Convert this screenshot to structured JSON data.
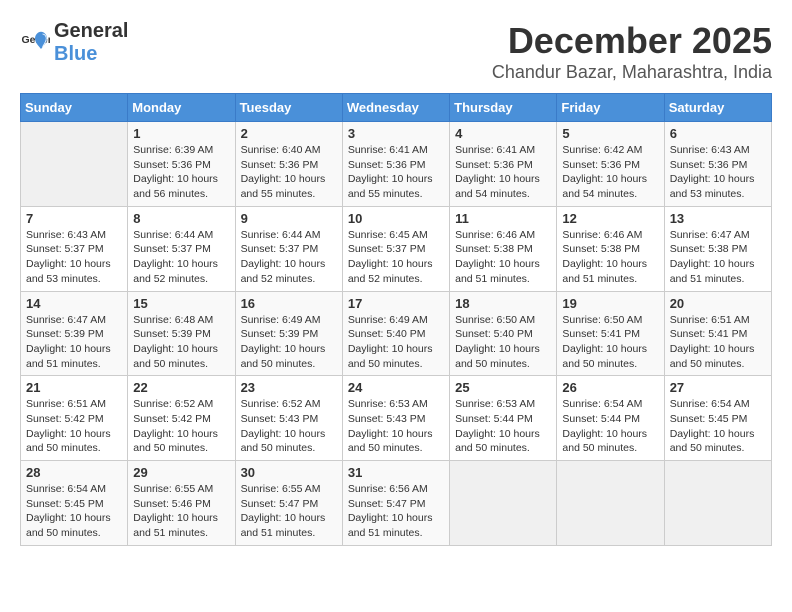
{
  "logo": {
    "general": "General",
    "blue": "Blue"
  },
  "title": "December 2025",
  "location": "Chandur Bazar, Maharashtra, India",
  "weekdays": [
    "Sunday",
    "Monday",
    "Tuesday",
    "Wednesday",
    "Thursday",
    "Friday",
    "Saturday"
  ],
  "weeks": [
    [
      {
        "day": "",
        "info": ""
      },
      {
        "day": "1",
        "info": "Sunrise: 6:39 AM\nSunset: 5:36 PM\nDaylight: 10 hours\nand 56 minutes."
      },
      {
        "day": "2",
        "info": "Sunrise: 6:40 AM\nSunset: 5:36 PM\nDaylight: 10 hours\nand 55 minutes."
      },
      {
        "day": "3",
        "info": "Sunrise: 6:41 AM\nSunset: 5:36 PM\nDaylight: 10 hours\nand 55 minutes."
      },
      {
        "day": "4",
        "info": "Sunrise: 6:41 AM\nSunset: 5:36 PM\nDaylight: 10 hours\nand 54 minutes."
      },
      {
        "day": "5",
        "info": "Sunrise: 6:42 AM\nSunset: 5:36 PM\nDaylight: 10 hours\nand 54 minutes."
      },
      {
        "day": "6",
        "info": "Sunrise: 6:43 AM\nSunset: 5:36 PM\nDaylight: 10 hours\nand 53 minutes."
      }
    ],
    [
      {
        "day": "7",
        "info": "Sunrise: 6:43 AM\nSunset: 5:37 PM\nDaylight: 10 hours\nand 53 minutes."
      },
      {
        "day": "8",
        "info": "Sunrise: 6:44 AM\nSunset: 5:37 PM\nDaylight: 10 hours\nand 52 minutes."
      },
      {
        "day": "9",
        "info": "Sunrise: 6:44 AM\nSunset: 5:37 PM\nDaylight: 10 hours\nand 52 minutes."
      },
      {
        "day": "10",
        "info": "Sunrise: 6:45 AM\nSunset: 5:37 PM\nDaylight: 10 hours\nand 52 minutes."
      },
      {
        "day": "11",
        "info": "Sunrise: 6:46 AM\nSunset: 5:38 PM\nDaylight: 10 hours\nand 51 minutes."
      },
      {
        "day": "12",
        "info": "Sunrise: 6:46 AM\nSunset: 5:38 PM\nDaylight: 10 hours\nand 51 minutes."
      },
      {
        "day": "13",
        "info": "Sunrise: 6:47 AM\nSunset: 5:38 PM\nDaylight: 10 hours\nand 51 minutes."
      }
    ],
    [
      {
        "day": "14",
        "info": "Sunrise: 6:47 AM\nSunset: 5:39 PM\nDaylight: 10 hours\nand 51 minutes."
      },
      {
        "day": "15",
        "info": "Sunrise: 6:48 AM\nSunset: 5:39 PM\nDaylight: 10 hours\nand 50 minutes."
      },
      {
        "day": "16",
        "info": "Sunrise: 6:49 AM\nSunset: 5:39 PM\nDaylight: 10 hours\nand 50 minutes."
      },
      {
        "day": "17",
        "info": "Sunrise: 6:49 AM\nSunset: 5:40 PM\nDaylight: 10 hours\nand 50 minutes."
      },
      {
        "day": "18",
        "info": "Sunrise: 6:50 AM\nSunset: 5:40 PM\nDaylight: 10 hours\nand 50 minutes."
      },
      {
        "day": "19",
        "info": "Sunrise: 6:50 AM\nSunset: 5:41 PM\nDaylight: 10 hours\nand 50 minutes."
      },
      {
        "day": "20",
        "info": "Sunrise: 6:51 AM\nSunset: 5:41 PM\nDaylight: 10 hours\nand 50 minutes."
      }
    ],
    [
      {
        "day": "21",
        "info": "Sunrise: 6:51 AM\nSunset: 5:42 PM\nDaylight: 10 hours\nand 50 minutes."
      },
      {
        "day": "22",
        "info": "Sunrise: 6:52 AM\nSunset: 5:42 PM\nDaylight: 10 hours\nand 50 minutes."
      },
      {
        "day": "23",
        "info": "Sunrise: 6:52 AM\nSunset: 5:43 PM\nDaylight: 10 hours\nand 50 minutes."
      },
      {
        "day": "24",
        "info": "Sunrise: 6:53 AM\nSunset: 5:43 PM\nDaylight: 10 hours\nand 50 minutes."
      },
      {
        "day": "25",
        "info": "Sunrise: 6:53 AM\nSunset: 5:44 PM\nDaylight: 10 hours\nand 50 minutes."
      },
      {
        "day": "26",
        "info": "Sunrise: 6:54 AM\nSunset: 5:44 PM\nDaylight: 10 hours\nand 50 minutes."
      },
      {
        "day": "27",
        "info": "Sunrise: 6:54 AM\nSunset: 5:45 PM\nDaylight: 10 hours\nand 50 minutes."
      }
    ],
    [
      {
        "day": "28",
        "info": "Sunrise: 6:54 AM\nSunset: 5:45 PM\nDaylight: 10 hours\nand 50 minutes."
      },
      {
        "day": "29",
        "info": "Sunrise: 6:55 AM\nSunset: 5:46 PM\nDaylight: 10 hours\nand 51 minutes."
      },
      {
        "day": "30",
        "info": "Sunrise: 6:55 AM\nSunset: 5:47 PM\nDaylight: 10 hours\nand 51 minutes."
      },
      {
        "day": "31",
        "info": "Sunrise: 6:56 AM\nSunset: 5:47 PM\nDaylight: 10 hours\nand 51 minutes."
      },
      {
        "day": "",
        "info": ""
      },
      {
        "day": "",
        "info": ""
      },
      {
        "day": "",
        "info": ""
      }
    ]
  ]
}
